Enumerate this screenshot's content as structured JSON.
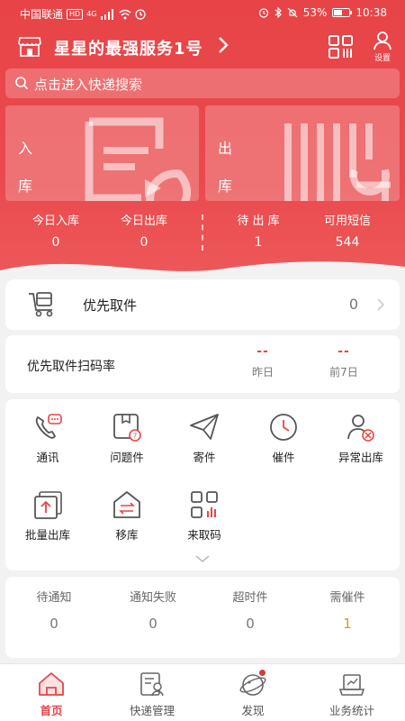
{
  "colors": {
    "brand": "#e84448",
    "gold": "#c9a227"
  },
  "status_bar": {
    "carrier": "中国联通",
    "network_badge": "HD",
    "signal_type": "4G",
    "battery": "53%",
    "battery_fraction": 0.53,
    "time": "10:38"
  },
  "header": {
    "store_name": "星星的最强服务1号",
    "settings_label": "设置",
    "icons": [
      "store-icon",
      "scan-code-icon",
      "user-settings-icon"
    ]
  },
  "search": {
    "placeholder": "点击进入快递搜索"
  },
  "tiles": [
    {
      "line1": "入",
      "line2": "库"
    },
    {
      "line1": "出",
      "line2": "库"
    }
  ],
  "stats": [
    {
      "label": "今日入库",
      "value": "0"
    },
    {
      "label": "今日出库",
      "value": "0"
    },
    {
      "label": "待 出 库",
      "value": "1"
    },
    {
      "label": "可用短信",
      "value": "544"
    }
  ],
  "priority": {
    "label": "优先取件",
    "count": "0"
  },
  "scan_rate": {
    "label": "优先取件扫码率",
    "yesterday": {
      "value": "--",
      "label": "昨日"
    },
    "last7": {
      "value": "--",
      "label": "前7日"
    }
  },
  "functions": [
    {
      "label": "通讯",
      "icon": "phone-chat-icon"
    },
    {
      "label": "问题件",
      "icon": "problem-parcel-icon"
    },
    {
      "label": "寄件",
      "icon": "paper-plane-icon"
    },
    {
      "label": "催件",
      "icon": "clock-icon"
    },
    {
      "label": "异常出库",
      "icon": "user-error-icon"
    },
    {
      "label": "批量出库",
      "icon": "batch-out-icon"
    },
    {
      "label": "移库",
      "icon": "move-stock-icon"
    },
    {
      "label": "来取码",
      "icon": "pickup-code-icon"
    }
  ],
  "notify": [
    {
      "label": "待通知",
      "value": "0"
    },
    {
      "label": "通知失败",
      "value": "0"
    },
    {
      "label": "超时件",
      "value": "0"
    },
    {
      "label": "需催件",
      "value": "1"
    }
  ],
  "tabs": [
    {
      "label": "首页",
      "icon": "home-icon",
      "active": true
    },
    {
      "label": "快递管理",
      "icon": "parcel-manage-icon"
    },
    {
      "label": "发现",
      "icon": "discover-icon",
      "badge": true
    },
    {
      "label": "业务统计",
      "icon": "statistics-icon"
    }
  ]
}
